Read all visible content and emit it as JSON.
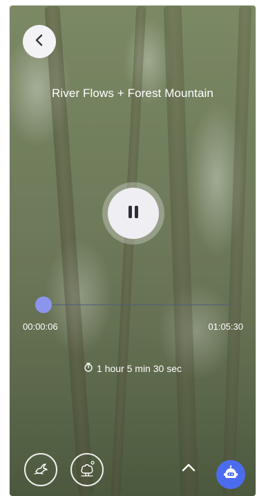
{
  "player": {
    "title": "River Flows + Forest Mountain",
    "elapsed": "00:00:06",
    "total": "01:05:30",
    "progress_fraction": 0.0015,
    "duration_label": "1 hour 5 min 30 sec",
    "state": "playing"
  },
  "icons": {
    "back": "chevron-left-icon",
    "pause": "pause-icon",
    "timer": "timer-icon",
    "bird": "bird-icon",
    "nature": "tree-icon",
    "expand": "chevron-up-icon",
    "assistant": "robot-icon"
  },
  "colors": {
    "accent": "#8c95ee",
    "assistant_button": "#4c6cef"
  }
}
